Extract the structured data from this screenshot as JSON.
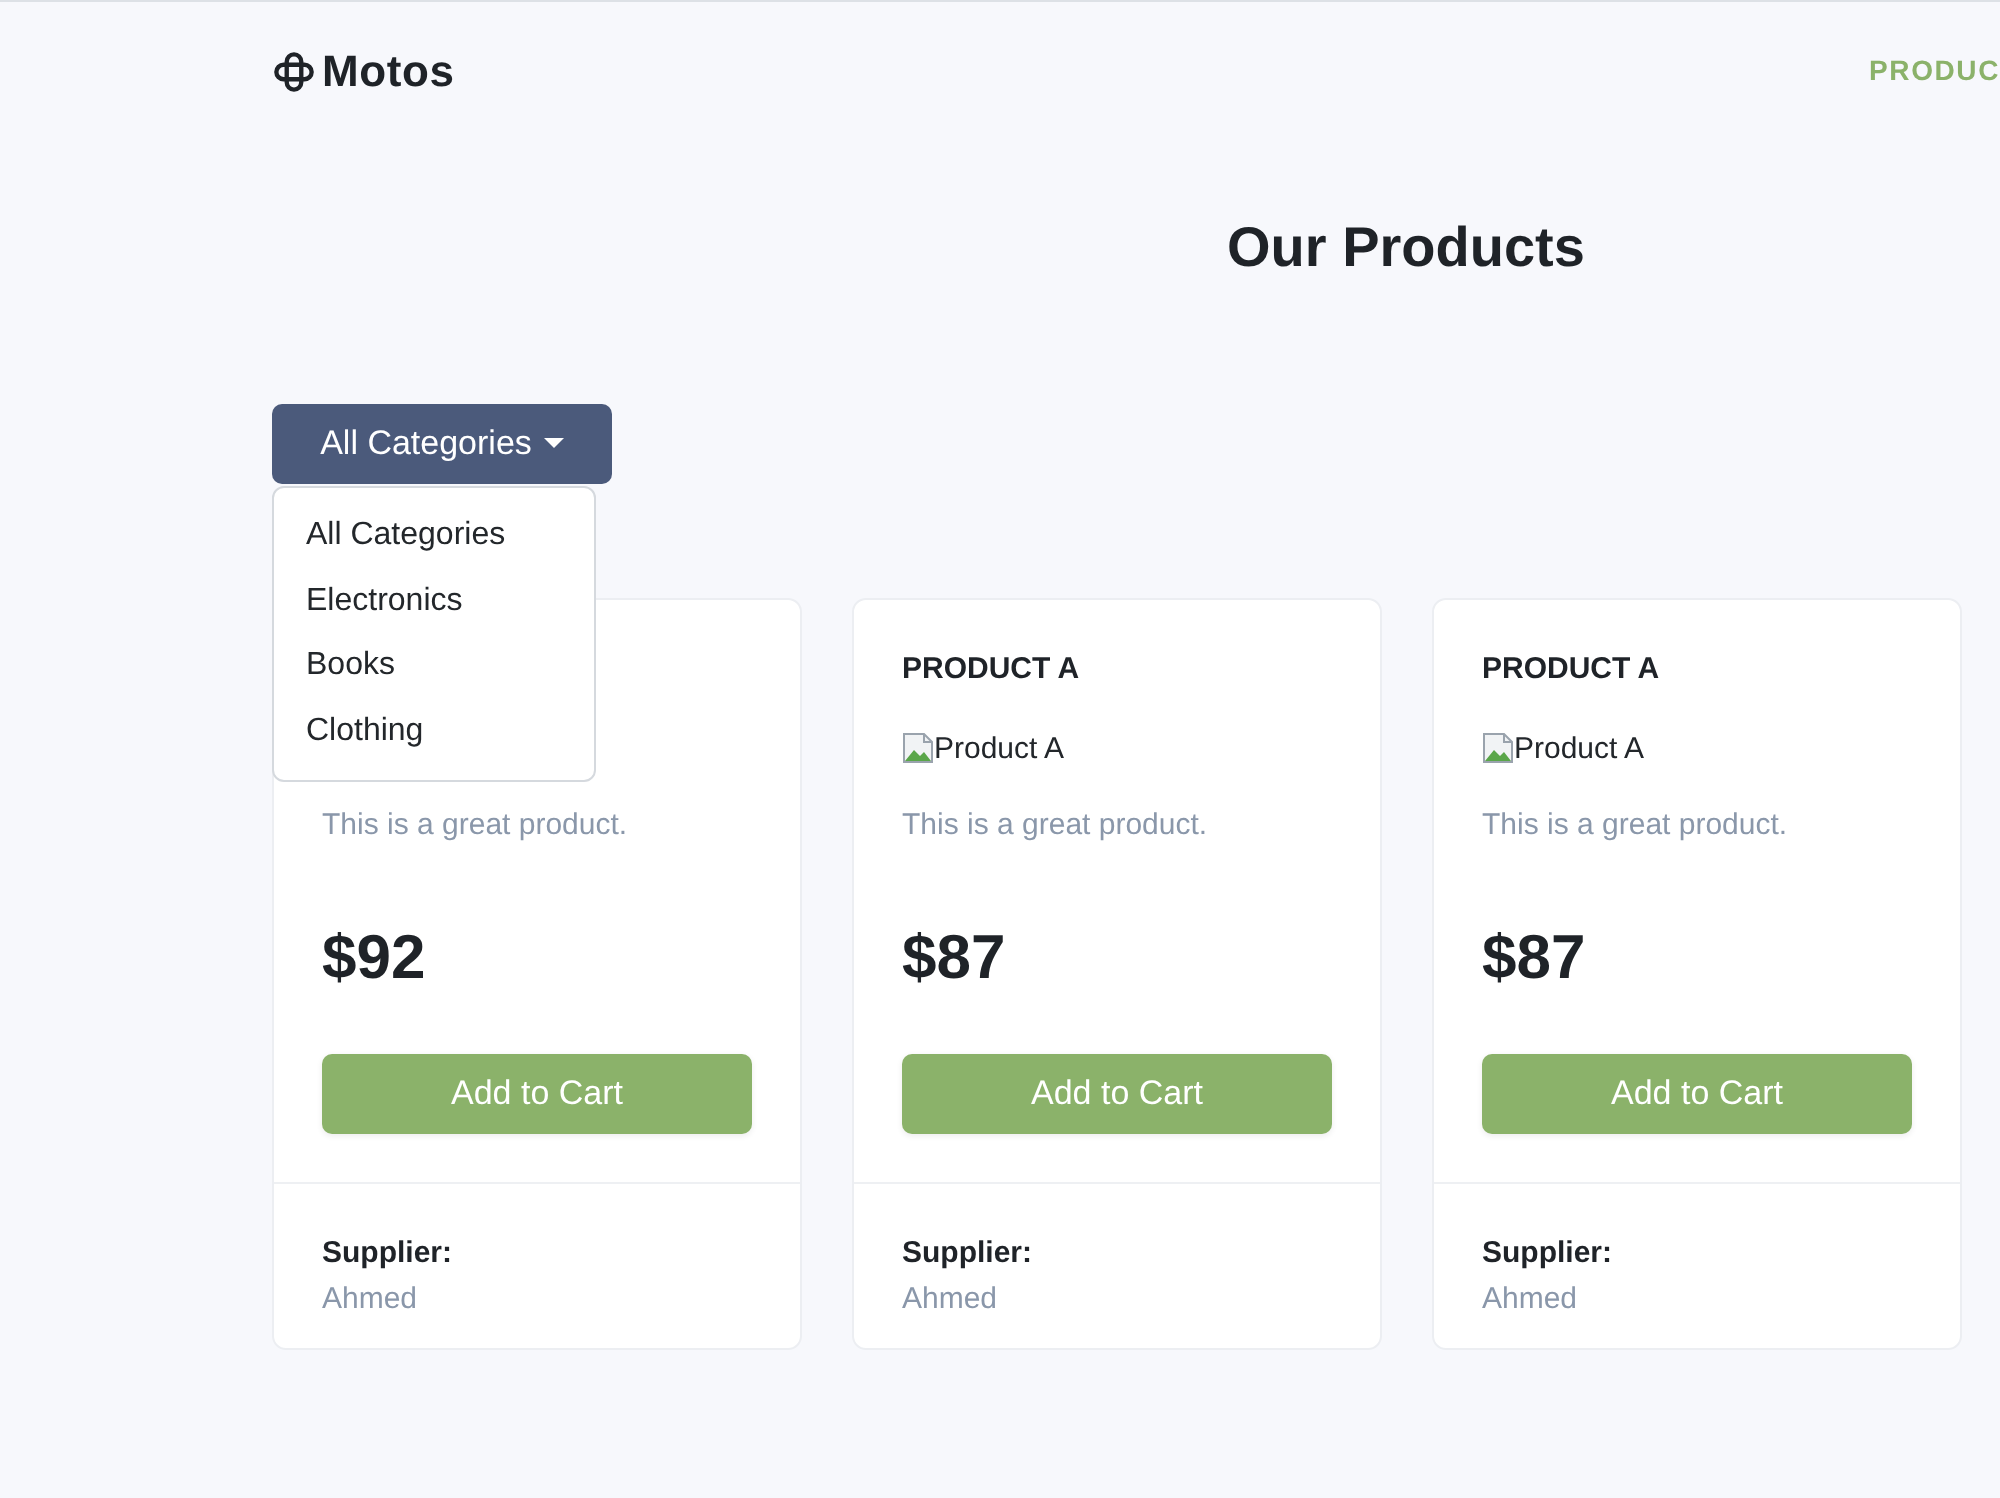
{
  "header": {
    "logo": "Motos",
    "nav": [
      {
        "label": "PRODUC"
      }
    ]
  },
  "page_title": "Our Products",
  "category_filter": {
    "label": "All Categories",
    "open": true,
    "options": [
      "All Categories",
      "Electronics",
      "Books",
      "Clothing"
    ]
  },
  "products": [
    {
      "description": "This is a great product.",
      "price": "$92",
      "button": "Add to Cart",
      "supplier_label": "Supplier:",
      "supplier": "Ahmed"
    },
    {
      "title": "PRODUCT A",
      "image_alt": "Product A",
      "description": "This is a great product.",
      "price": "$87",
      "button": "Add to Cart",
      "supplier_label": "Supplier:",
      "supplier": "Ahmed"
    },
    {
      "title": "PRODUCT A",
      "image_alt": "Product A",
      "description": "This is a great product.",
      "price": "$87",
      "button": "Add to Cart",
      "supplier_label": "Supplier:",
      "supplier": "Ahmed"
    }
  ]
}
